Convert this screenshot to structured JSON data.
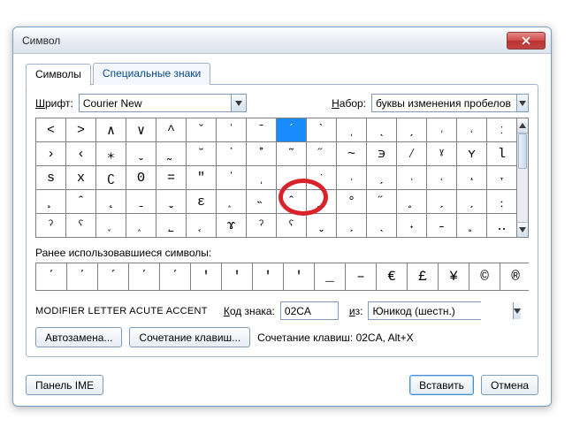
{
  "window": {
    "title": "Символ"
  },
  "tabs": {
    "symbols": "Символы",
    "special": "Специальные знаки"
  },
  "font": {
    "label_html": "<span class='unicode-under'>Ш</span>рифт:",
    "value": "Courier New"
  },
  "subset": {
    "label_html": "<span class='unicode-under'>Н</span>абор:",
    "value": "буквы изменения пробелов"
  },
  "grid": {
    "rows": [
      [
        "<",
        ">",
        "∧",
        "∨",
        "^",
        "ˇ",
        "ˈ",
        "ˉ",
        "ˊ",
        "ˋ",
        "ˌ",
        "ˎ",
        "ˏ",
        "˒",
        "˓",
        "ː"
      ],
      [
        "›",
        "‹",
        "⁎",
        "ˬ",
        "˷",
        "˘",
        "˙",
        "˚",
        "˜",
        "˝",
        "~",
        "϶",
        "⁄",
        "ˠ",
        "ʏ",
        "l"
      ],
      [
        "s",
        "x",
        "ʗ",
        "ʘ",
        "=",
        "″",
        "ˈ",
        "ˌ",
        "ˏ",
        "ˑ",
        "˒",
        "ˏ",
        "˒",
        "˓",
        "˔",
        "˕"
      ],
      [
        "¸",
        "ˆ",
        "˛",
        "ˍ",
        "ˬ",
        "ɛ",
        "˰",
        "˵",
        "ˆ",
        "˷",
        "°",
        "˝",
        "˳",
        "ˏ",
        "ˏ",
        "﹕"
      ],
      [
        "ˀ",
        "ˁ",
        "˯",
        "˰",
        "˾",
        "˱",
        "ɤ",
        "ˀ",
        "ˁ",
        "ˬ",
        "ˏ",
        "ˎ",
        "˖",
        "˗",
        "˳",
        "‥"
      ]
    ],
    "selected": {
      "row": 0,
      "col": 8
    }
  },
  "recent": {
    "label": "Ранее использовавшиеся символы:",
    "items": [
      "ˊ",
      "ˊ",
      "ˊ",
      "ˊ",
      "ˊ",
      "ʹ",
      "ʹ",
      "ʹ",
      "ʹ",
      "_",
      "–",
      "€",
      "£",
      "¥",
      "©",
      "®"
    ]
  },
  "charname": "MODIFIER LETTER ACUTE ACCENT",
  "code": {
    "label_html": "<span class='unicode-under'>К</span>од знака:",
    "value": "02CA"
  },
  "from": {
    "label_html": "<span class='unicode-under'>и</span>з:",
    "value": "Юникод (шестн.)"
  },
  "buttons": {
    "autocorrect": "Автозамена...",
    "shortcut": "Сочетание клавиш...",
    "shortcut_text": "Сочетание клавиш: 02CA, Alt+X",
    "ime": "Панель IME",
    "insert": "Вставить",
    "cancel": "Отмена"
  }
}
